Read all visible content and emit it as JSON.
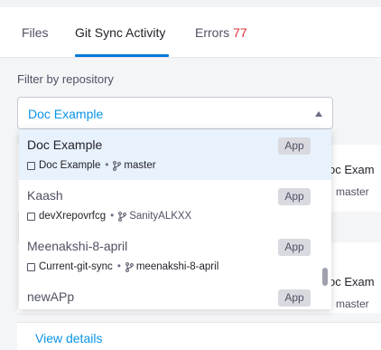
{
  "tabs": [
    {
      "label": "Files"
    },
    {
      "label": "Git Sync Activity"
    },
    {
      "label": "Errors",
      "count": "77"
    }
  ],
  "filter": {
    "label": "Filter by repository",
    "selected_value": "Doc Example"
  },
  "options": [
    {
      "name": "Doc Example",
      "badge": "App",
      "repo": "Doc Example",
      "branch": "master"
    },
    {
      "name": "Kaash",
      "badge": "App",
      "repo": "devXrepovrfcg",
      "branch": "SanityALKXX"
    },
    {
      "name": "Meenakshi-8-april",
      "badge": "App",
      "repo": "Current-git-sync",
      "branch": "meenakshi-8-april"
    },
    {
      "name": "newAPp",
      "badge": "App"
    }
  ],
  "background": {
    "card1_title": "oc Exam",
    "card1_sub": "master",
    "card2_title": "oc Exam",
    "card2_sub": "master"
  },
  "view_details": "View details",
  "colors": {
    "accent": "#0278d5",
    "link": "#0b94e6",
    "error": "#e0303b"
  }
}
